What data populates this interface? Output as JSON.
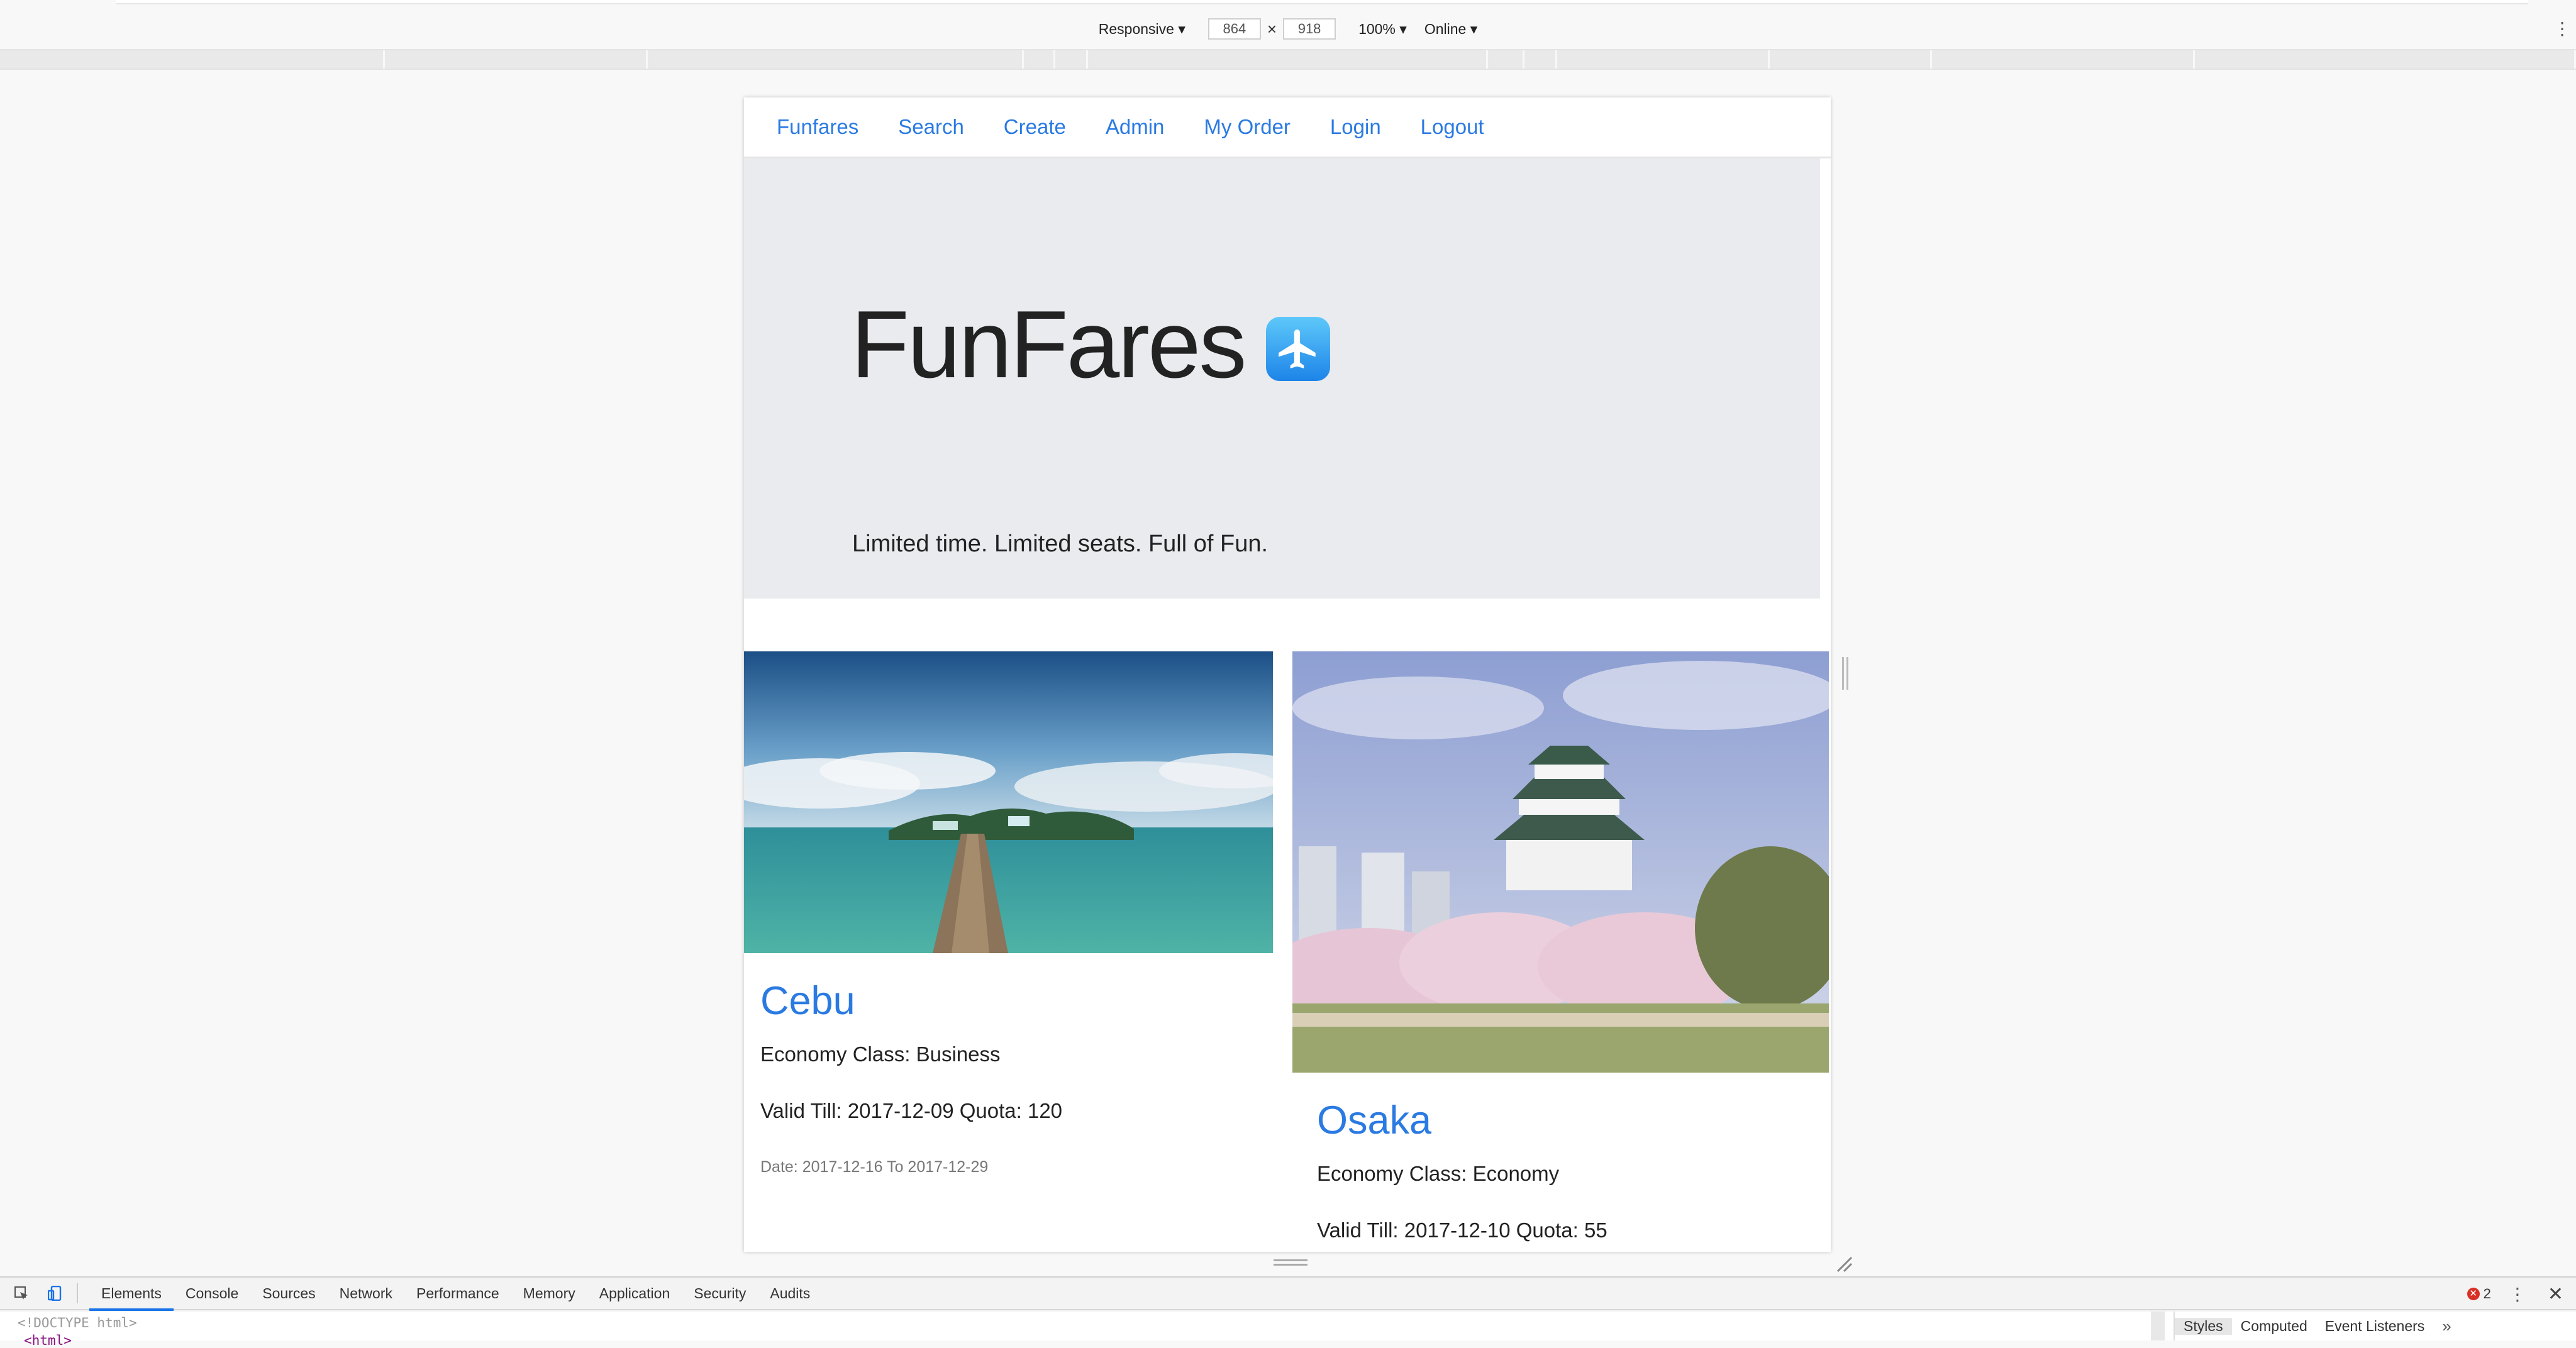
{
  "device_toolbar": {
    "mode": "Responsive",
    "width": "864",
    "height": "918",
    "times": "×",
    "zoom": "100%",
    "network": "Online",
    "more_icon": "kebab-menu-icon"
  },
  "site": {
    "nav": [
      {
        "label": "Funfares"
      },
      {
        "label": "Search"
      },
      {
        "label": "Create"
      },
      {
        "label": "Admin"
      },
      {
        "label": "My Order"
      },
      {
        "label": "Login"
      },
      {
        "label": "Logout"
      }
    ],
    "hero": {
      "title": "FunFares",
      "icon": "airplane-icon",
      "tagline": "Limited time. Limited seats. Full of Fun."
    },
    "fares": [
      {
        "city": "Cebu",
        "class_line": "Economy Class: Business",
        "valid_line": "Valid Till: 2017-12-09 Quota: 120",
        "date_line": "Date: 2017-12-16 To 2017-12-29"
      },
      {
        "city": "Osaka",
        "class_line": "Economy Class: Economy",
        "valid_line": "Valid Till: 2017-12-10 Quota: 55"
      }
    ],
    "link_color": "#2a7ae2"
  },
  "devtools": {
    "tabs": [
      {
        "label": "Elements"
      },
      {
        "label": "Console"
      },
      {
        "label": "Sources"
      },
      {
        "label": "Network"
      },
      {
        "label": "Performance"
      },
      {
        "label": "Memory"
      },
      {
        "label": "Application"
      },
      {
        "label": "Security"
      },
      {
        "label": "Audits"
      }
    ],
    "error_count": "2",
    "code_line_1": "<!DOCTYPE html>",
    "code_line_2": "<html>",
    "side_tabs": [
      {
        "label": "Styles"
      },
      {
        "label": "Computed"
      },
      {
        "label": "Event Listeners"
      }
    ],
    "side_more": "»"
  }
}
